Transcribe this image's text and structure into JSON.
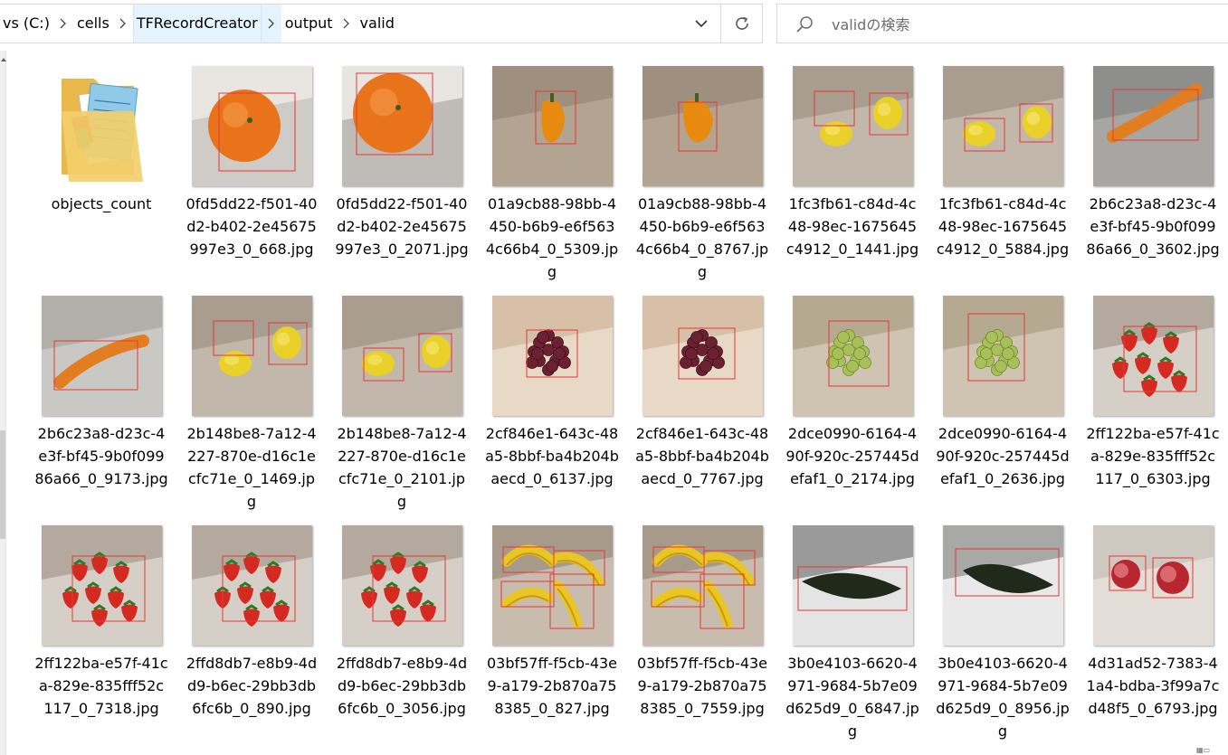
{
  "address": {
    "crumbs": [
      "vs (C:)",
      "cells",
      "TFRecordCreator",
      "output",
      "valid"
    ],
    "highlighted_crumb": 2
  },
  "search": {
    "placeholder": "validの検索"
  },
  "icons": {
    "dropdown": "chevron-down-icon",
    "refresh": "refresh-icon",
    "search": "search-icon"
  },
  "files": [
    {
      "name": "objects_count",
      "kind": "folder"
    },
    {
      "name": "0fd5dd22-f501-40d2-b402-2e45675997e3_0_668.jpg",
      "subject": "orange"
    },
    {
      "name": "0fd5dd22-f501-40d2-b402-2e45675997e3_0_2071.jpg",
      "subject": "orange"
    },
    {
      "name": "01a9cb88-98bb-4450-b6b9-e6f5634c66b4_0_5309.jpg",
      "subject": "pepper"
    },
    {
      "name": "01a9cb88-98bb-4450-b6b9-e6f5634c66b4_0_8767.jpg",
      "subject": "pepper"
    },
    {
      "name": "1fc3fb61-c84d-4c48-98ec-1675645c4912_0_1441.jpg",
      "subject": "lemons"
    },
    {
      "name": "1fc3fb61-c84d-4c48-98ec-1675645c4912_0_5884.jpg",
      "subject": "lemons"
    },
    {
      "name": "2b6c23a8-d23c-4e3f-bf45-9b0f09986a66_0_3602.jpg",
      "subject": "carrot"
    },
    {
      "name": "2b6c23a8-d23c-4e3f-bf45-9b0f09986a66_0_9173.jpg",
      "subject": "carrot"
    },
    {
      "name": "2b148be8-7a12-4227-870e-d16c1ecfc71e_0_1469.jpg",
      "subject": "lemons"
    },
    {
      "name": "2b148be8-7a12-4227-870e-d16c1ecfc71e_0_2101.jpg",
      "subject": "lemons"
    },
    {
      "name": "2cf846e1-643c-48a5-8bbf-ba4b204baecd_0_6137.jpg",
      "subject": "grape-red"
    },
    {
      "name": "2cf846e1-643c-48a5-8bbf-ba4b204baecd_0_7767.jpg",
      "subject": "grape-red"
    },
    {
      "name": "2dce0990-6164-490f-920c-257445defaf1_0_2174.jpg",
      "subject": "grape-green"
    },
    {
      "name": "2dce0990-6164-490f-920c-257445defaf1_0_2636.jpg",
      "subject": "grape-green"
    },
    {
      "name": "2ff122ba-e57f-41ca-829e-835fff52c117_0_6303.jpg",
      "subject": "strawberries"
    },
    {
      "name": "2ff122ba-e57f-41ca-829e-835fff52c117_0_7318.jpg",
      "subject": "strawberries"
    },
    {
      "name": "2ffd8db7-e8b9-4dd9-b6ec-29bb3db6fc6b_0_890.jpg",
      "subject": "strawberries"
    },
    {
      "name": "2ffd8db7-e8b9-4dd9-b6ec-29bb3db6fc6b_0_3056.jpg",
      "subject": "strawberries"
    },
    {
      "name": "03bf57ff-f5cb-43e9-a179-2b870a758385_0_827.jpg",
      "subject": "bananas"
    },
    {
      "name": "03bf57ff-f5cb-43e9-a179-2b870a758385_0_7559.jpg",
      "subject": "bananas"
    },
    {
      "name": "3b0e4103-6620-4971-9684-5b7e09d625d9_0_6847.jpg",
      "subject": "zucchini"
    },
    {
      "name": "3b0e4103-6620-4971-9684-5b7e09d625d9_0_8956.jpg",
      "subject": "zucchini"
    },
    {
      "name": "4d31ad52-7383-41a4-bdba-3f99a7cd48f5_0_6793.jpg",
      "subject": "apples"
    }
  ],
  "colors": {
    "crumb_highlight": "#e5f3ff",
    "bbox": "#e53935",
    "border": "#d9d9d9"
  }
}
